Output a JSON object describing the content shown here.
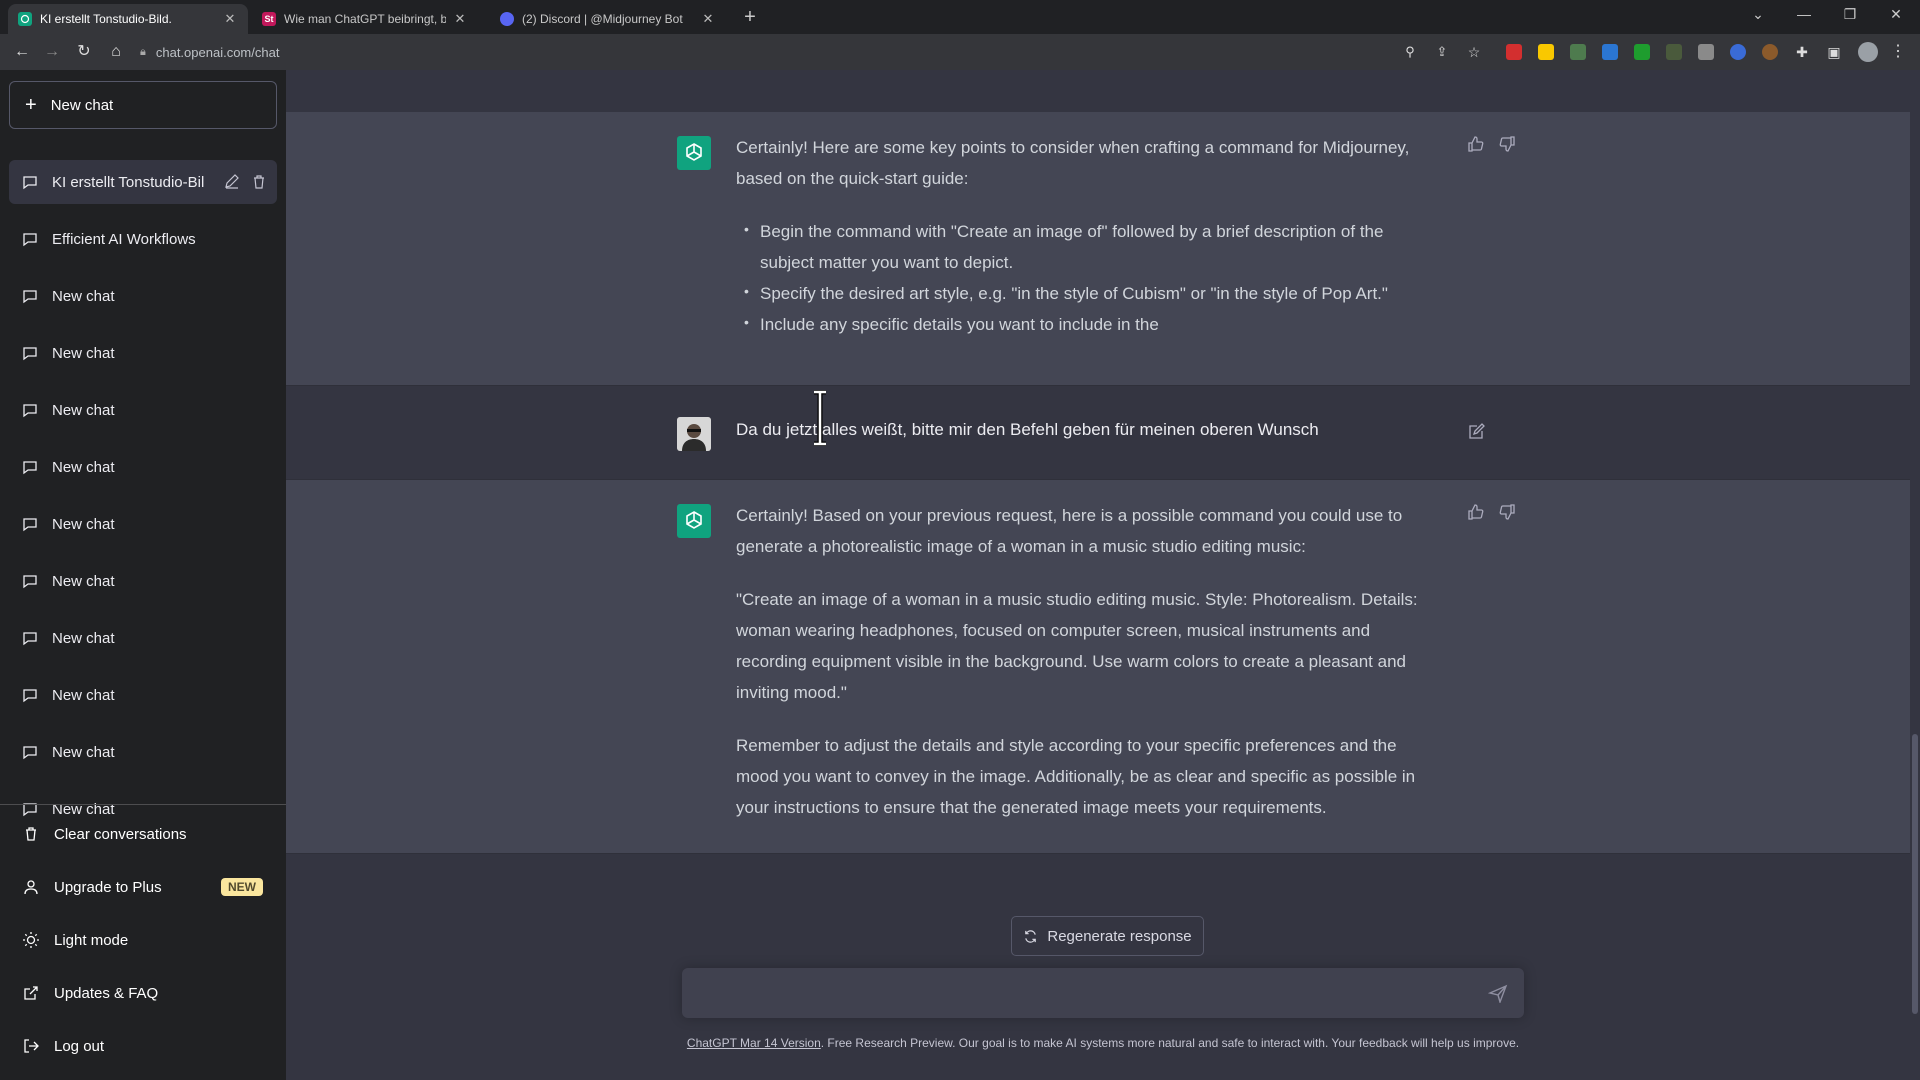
{
  "browser": {
    "tabs": [
      {
        "title": "KI erstellt Tonstudio-Bild.",
        "active": true,
        "favicon": "chatgpt-favicon"
      },
      {
        "title": "Wie man ChatGPT beibringt, bes",
        "active": false,
        "favicon": "st-favicon"
      },
      {
        "title": "(2) Discord | @Midjourney Bot",
        "active": false,
        "favicon": "discord-favicon"
      }
    ],
    "url": "chat.openai.com/chat"
  },
  "sidebar": {
    "new_chat_label": "New chat",
    "conversations": [
      {
        "label": "KI erstellt Tonstudio-Bil",
        "active": true
      },
      {
        "label": "Efficient AI Workflows"
      },
      {
        "label": "New chat"
      },
      {
        "label": "New chat"
      },
      {
        "label": "New chat"
      },
      {
        "label": "New chat"
      },
      {
        "label": "New chat"
      },
      {
        "label": "New chat"
      },
      {
        "label": "New chat"
      },
      {
        "label": "New chat"
      },
      {
        "label": "New chat"
      },
      {
        "label": "New chat"
      }
    ],
    "menu": {
      "clear": "Clear conversations",
      "upgrade": "Upgrade to Plus",
      "upgrade_badge": "NEW",
      "light_mode": "Light mode",
      "updates": "Updates & FAQ",
      "logout": "Log out"
    }
  },
  "messages": {
    "ai1": {
      "intro": "Certainly! Here are some key points to consider when crafting a command for Midjourney, based on the quick-start guide:",
      "bullets": [
        "Begin the command with \"Create an image of\" followed by a brief description of the subject matter you want to depict.",
        "Specify the desired art style, e.g. \"in the style of Cubism\" or \"in the style of Pop Art.\"",
        "Include any specific details you want to include in the"
      ]
    },
    "user1": {
      "text": "Da du jetzt alles weißt, bitte mir den Befehl geben für meinen oberen Wunsch"
    },
    "ai2": {
      "p1": "Certainly! Based on your previous request, here is a possible command you could use to generate a photorealistic image of a woman in a music studio editing music:",
      "p2": "\"Create an image of a woman in a music studio editing music. Style: Photorealism. Details: woman wearing headphones, focused on computer screen, musical instruments and recording equipment visible in the background. Use warm colors to create a pleasant and inviting mood.\"",
      "p3": "Remember to adjust the details and style according to your specific preferences and the mood you want to convey in the image. Additionally, be as clear and specific as possible in your instructions to ensure that the generated image meets your requirements."
    }
  },
  "composer": {
    "regenerate_label": "Regenerate response",
    "input_value": ""
  },
  "footer": {
    "link": "ChatGPT Mar 14 Version",
    "text": ". Free Research Preview. Our goal is to make AI systems more natural and safe to interact with. Your feedback will help us improve."
  },
  "colors": {
    "sidebar_bg": "#202123",
    "main_bg": "#343541",
    "ai_msg_bg": "#444654",
    "gpt_green": "#10a37f",
    "badge": "#fae69e"
  }
}
